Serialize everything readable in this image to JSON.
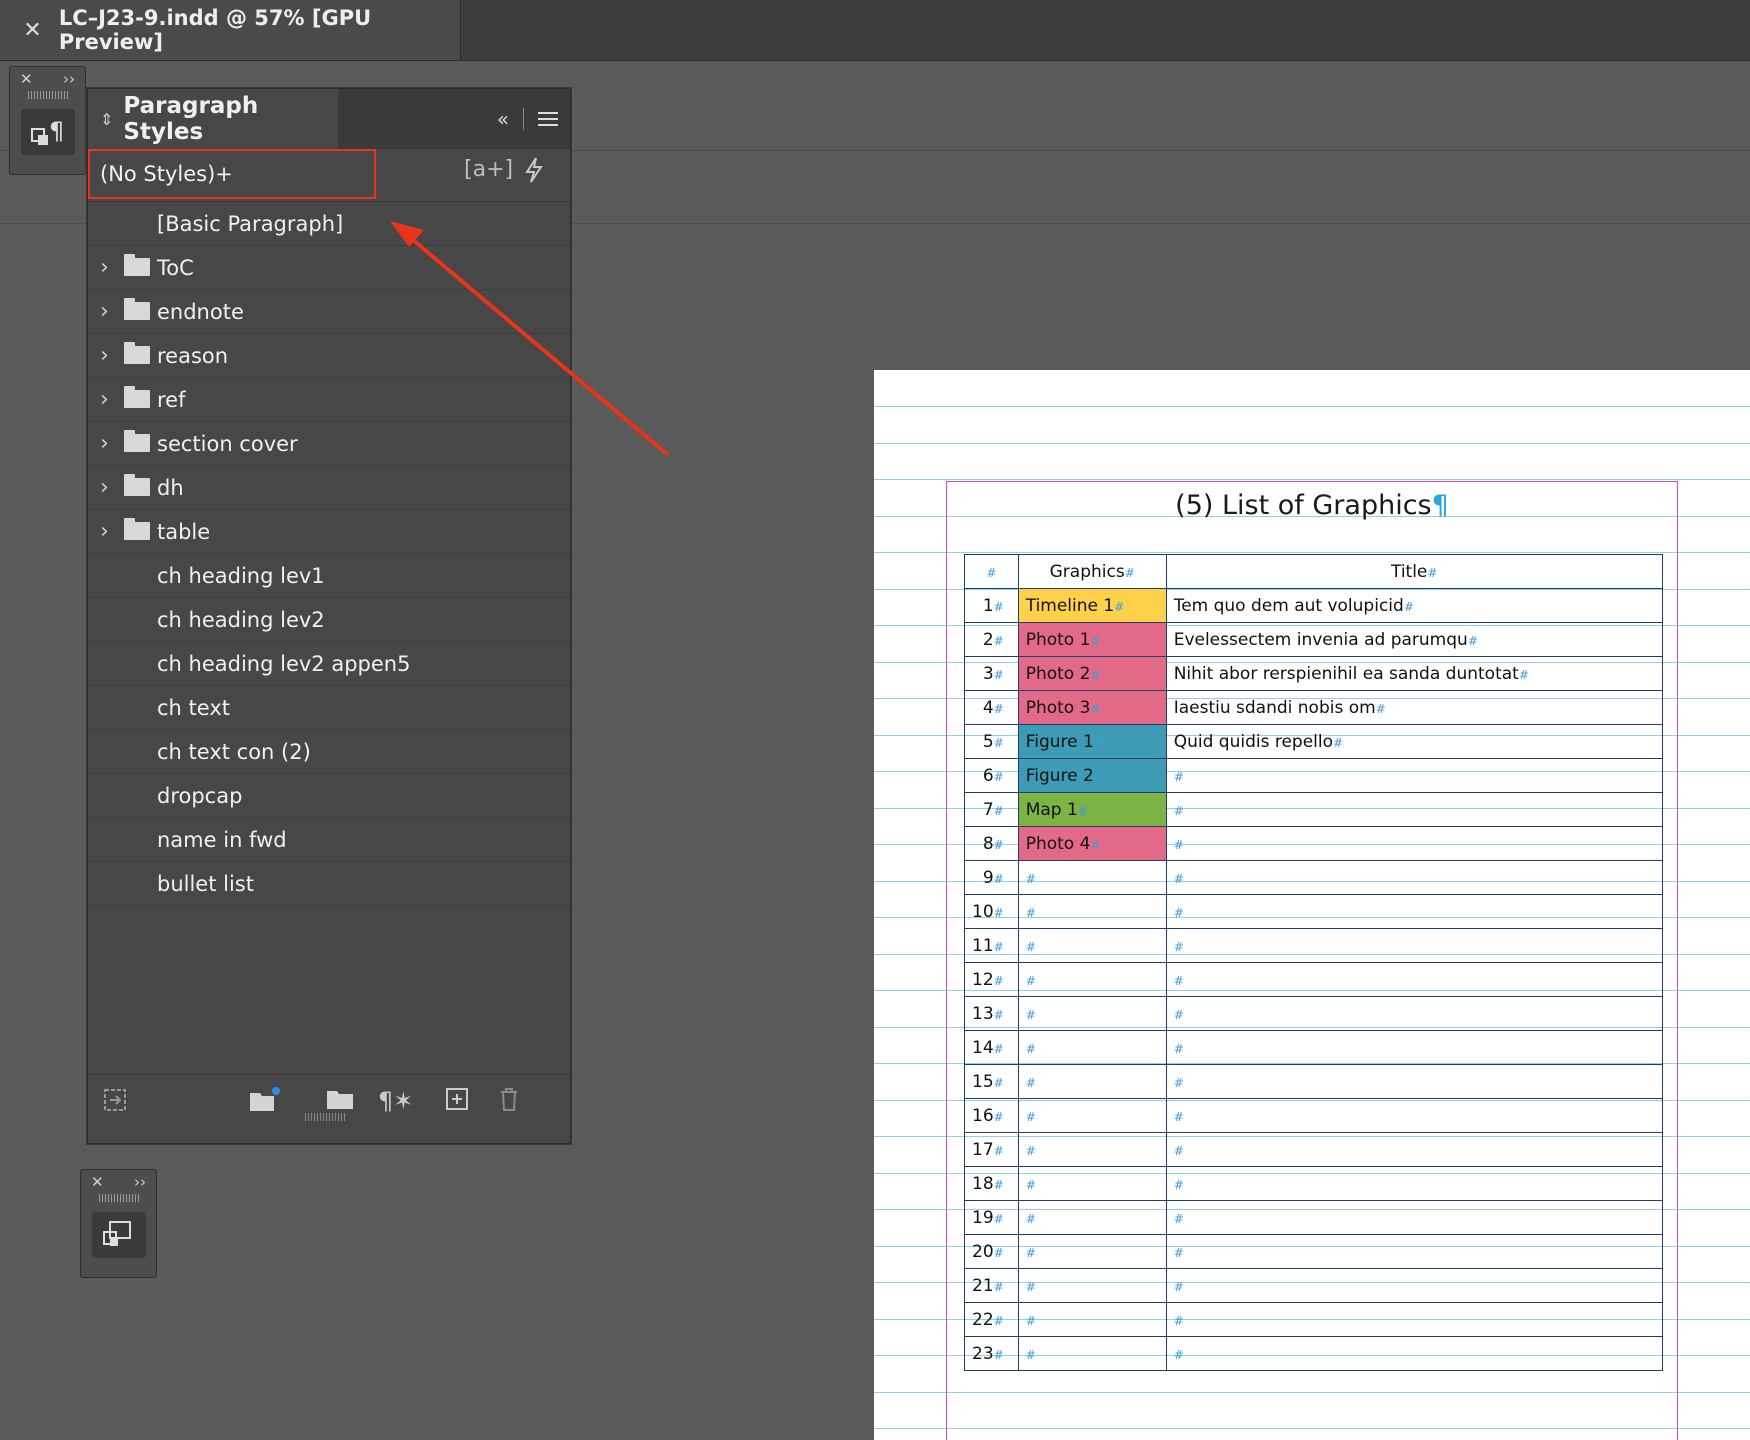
{
  "document_tab": {
    "close_glyph": "✕",
    "title": "LC–J23-9.indd @ 57% [GPU Preview]"
  },
  "panel": {
    "title": "Paragraph Styles",
    "current_style": "(No Styles)+",
    "new_override_label": "[a+]",
    "items": [
      {
        "label": "[Basic Paragraph]",
        "folder": false
      },
      {
        "label": "ToC",
        "folder": true
      },
      {
        "label": "endnote",
        "folder": true
      },
      {
        "label": "reason",
        "folder": true
      },
      {
        "label": "ref",
        "folder": true
      },
      {
        "label": "section cover",
        "folder": true
      },
      {
        "label": "dh",
        "folder": true
      },
      {
        "label": "table",
        "folder": true
      },
      {
        "label": "ch heading lev1",
        "folder": false
      },
      {
        "label": "ch heading lev2",
        "folder": false
      },
      {
        "label": "ch heading lev2 appen5",
        "folder": false
      },
      {
        "label": "ch text",
        "folder": false
      },
      {
        "label": "ch text con (2)",
        "folder": false
      },
      {
        "label": "dropcap",
        "folder": false
      },
      {
        "label": "name in fwd",
        "folder": false
      },
      {
        "label": "bullet list",
        "folder": false
      }
    ]
  },
  "document": {
    "title": "(5) List of Graphics",
    "pilcrow": "¶",
    "hash": "#",
    "headers": [
      "#",
      "Graphics",
      "Title"
    ],
    "rows": [
      {
        "n": "1",
        "graphic": "Timeline 1",
        "title": "Tem quo dem aut volupicid",
        "color": "yellow"
      },
      {
        "n": "2",
        "graphic": "Photo 1",
        "title": "Evelessectem invenia ad parumqu",
        "color": "pink"
      },
      {
        "n": "3",
        "graphic": "Photo 2",
        "title": "Nihit abor rerspienihil ea sanda duntotat",
        "color": "pink"
      },
      {
        "n": "4",
        "graphic": "Photo 3",
        "title": "Iaestiu sdandi nobis om",
        "color": "pink"
      },
      {
        "n": "5",
        "graphic": "Figure 1",
        "title": "Quid quidis repello",
        "color": "teal"
      },
      {
        "n": "6",
        "graphic": "Figure 2",
        "title": "",
        "color": "teal"
      },
      {
        "n": "7",
        "graphic": "Map 1",
        "title": "",
        "color": "green"
      },
      {
        "n": "8",
        "graphic": "Photo 4",
        "title": "",
        "color": "pink"
      },
      {
        "n": "9",
        "graphic": "",
        "title": "",
        "color": ""
      },
      {
        "n": "10",
        "graphic": "",
        "title": "",
        "color": ""
      },
      {
        "n": "11",
        "graphic": "",
        "title": "",
        "color": ""
      },
      {
        "n": "12",
        "graphic": "",
        "title": "",
        "color": ""
      },
      {
        "n": "13",
        "graphic": "",
        "title": "",
        "color": ""
      },
      {
        "n": "14",
        "graphic": "",
        "title": "",
        "color": ""
      },
      {
        "n": "15",
        "graphic": "",
        "title": "",
        "color": ""
      },
      {
        "n": "16",
        "graphic": "",
        "title": "",
        "color": ""
      },
      {
        "n": "17",
        "graphic": "",
        "title": "",
        "color": ""
      },
      {
        "n": "18",
        "graphic": "",
        "title": "",
        "color": ""
      },
      {
        "n": "19",
        "graphic": "",
        "title": "",
        "color": ""
      },
      {
        "n": "20",
        "graphic": "",
        "title": "",
        "color": ""
      },
      {
        "n": "21",
        "graphic": "",
        "title": "",
        "color": ""
      },
      {
        "n": "22",
        "graphic": "",
        "title": "",
        "color": ""
      },
      {
        "n": "23",
        "graphic": "",
        "title": "",
        "color": ""
      }
    ]
  },
  "colors": {
    "highlight_box": "#e8341c",
    "arrow": "#e8341c",
    "yellow": "#fdd24a",
    "pink": "#e36a86",
    "teal": "#3d9bb6",
    "green": "#7db245"
  }
}
